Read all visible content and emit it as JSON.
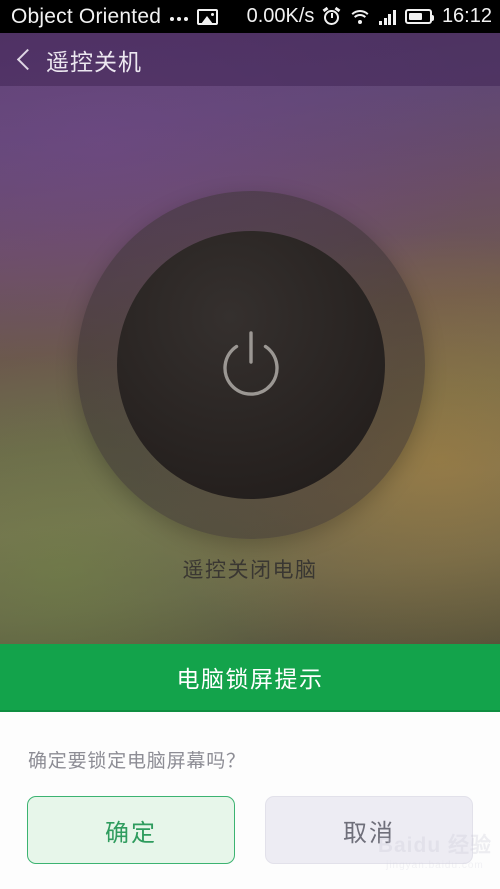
{
  "status_bar": {
    "carrier": "Object Oriented",
    "overflow_dots_icon": "more-dots-icon",
    "image_icon": "photo-icon",
    "network_speed": "0.00K/s",
    "alarm_icon": "alarm-clock-icon",
    "wifi_icon": "wifi-icon",
    "signal_icon": "cellular-signal-icon",
    "battery_icon": "battery-icon",
    "time": "16:12"
  },
  "title_bar": {
    "back_icon": "chevron-left-icon",
    "title": "遥控关机"
  },
  "main": {
    "power_icon": "power-button-icon",
    "caption": "遥控关闭电脑"
  },
  "dialog": {
    "header_title": "电脑锁屏提示",
    "message": "确定要锁定电脑屏幕吗？",
    "confirm_label": "确定",
    "cancel_label": "取消"
  },
  "watermark": {
    "main": "Baidu 经验",
    "sub": "jingyan.baidu.com"
  },
  "colors": {
    "status_bar_bg": "#000000",
    "title_bar_bg": "#3a1e4e",
    "dialog_header_green": "#13a34b",
    "confirm_green": "#2f9c5e",
    "cancel_gray": "#6f6f7a",
    "dialog_bg": "#fdfdfd"
  }
}
